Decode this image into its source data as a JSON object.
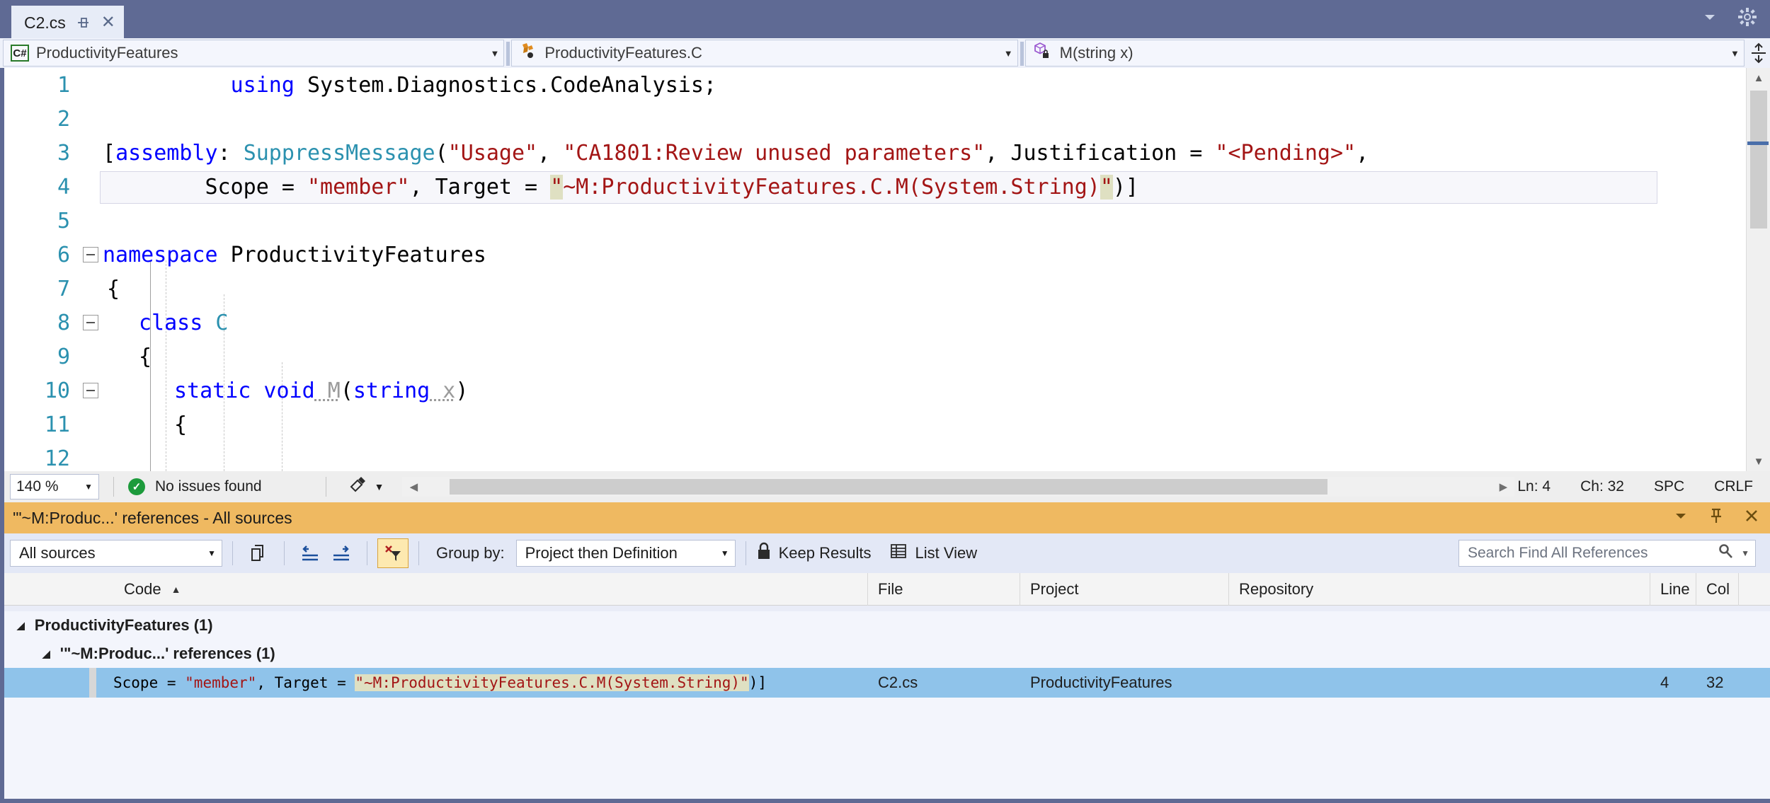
{
  "window": {
    "controls": {
      "dropdown": "chevron-down-icon",
      "settings": "gear-icon"
    }
  },
  "tab": {
    "label": "C2.cs",
    "pin_icon": "pin-icon",
    "close_icon": "close-icon"
  },
  "navbar": {
    "project_combo": {
      "icon": "csharp-file-icon",
      "value": "ProductivityFeatures",
      "arrow": "▼"
    },
    "type_combo": {
      "icon": "class-icon",
      "value": "ProductivityFeatures.C",
      "arrow": "▼"
    },
    "member_combo": {
      "icon": "method-private-icon",
      "value": "M(string x)",
      "arrow": "▼"
    },
    "split_button": "split-editor-icon"
  },
  "editor": {
    "lines": [
      {
        "num": "1",
        "fold": null
      },
      {
        "num": "2",
        "fold": null
      },
      {
        "num": "3",
        "fold": null
      },
      {
        "num": "4",
        "fold": null
      },
      {
        "num": "5",
        "fold": null
      },
      {
        "num": "6",
        "fold": "collapse"
      },
      {
        "num": "7",
        "fold": null
      },
      {
        "num": "8",
        "fold": "collapse"
      },
      {
        "num": "9",
        "fold": null
      },
      {
        "num": "10",
        "fold": "collapse"
      },
      {
        "num": "11",
        "fold": null
      },
      {
        "num": "12",
        "fold": null
      }
    ],
    "code": {
      "l1_using": "using",
      "l1_ns": " System.Diagnostics.CodeAnalysis;",
      "l3_open": "[",
      "l3_assembly": "assembly",
      "l3_colon": ": ",
      "l3_attr": "SuppressMessage",
      "l3_paren": "(",
      "l3_usage": "\"Usage\"",
      "l3_comma1": ", ",
      "l3_ca1801": "\"CA1801:Review unused parameters\"",
      "l3_comma2": ", ",
      "l3_just": "Justification = ",
      "l3_pending": "\"<Pending>\"",
      "l3_trailcomma": ",",
      "l4_scope": "        Scope = ",
      "l4_member": "\"member\"",
      "l4_comma": ", ",
      "l4_target": "Target = ",
      "l4_quote_open": "\"",
      "l4_ref": "~M:ProductivityFeatures.C.M(System.String)",
      "l4_quote_close": "\"",
      "l4_tail": ")]",
      "l6_kw": "namespace",
      "l6_name": " ProductivityFeatures",
      "l7": "{",
      "l8_kw": "class",
      "l8_name": " C",
      "l9": "{",
      "l10_static": "static",
      "l10_void": " void",
      "l10_m": " M",
      "l10_paren1": "(",
      "l10_string": "string",
      "l10_x": " x",
      "l10_paren2": ")",
      "l11": "{"
    }
  },
  "status": {
    "zoom": "140 %",
    "zoom_arrow": "▼",
    "issues_icon": "check-circle-icon",
    "issues": "No issues found",
    "brush_icon": "cleanup-brush-icon",
    "brush_arrow": "▼",
    "scroll_left": "◀",
    "scroll_right": "▶",
    "line": "Ln: 4",
    "char": "Ch: 32",
    "spaces": "SPC",
    "eol": "CRLF"
  },
  "find_all_references": {
    "title": "'\"~M:Produc...' references - All sources",
    "header_buttons": {
      "dropdown": "chevron-down-icon",
      "pin": "pin-icon",
      "close": "close-icon"
    },
    "toolbar": {
      "sources_value": "All sources",
      "sources_arrow": "▼",
      "copy_icon": "copy-icon",
      "prev_icon": "previous-location-icon",
      "next_icon": "next-location-icon",
      "clear_filter_icon": "clear-filter-icon",
      "group_by_label": "Group by:",
      "group_by_value": "Project then Definition",
      "group_by_arrow": "▼",
      "keep_results_icon": "lock-icon",
      "keep_results_label": "Keep Results",
      "list_view_icon": "grid-icon",
      "list_view_label": "List View",
      "search_placeholder": "Search Find All References",
      "search_icon": "search-icon",
      "search_arrow": "▼"
    },
    "columns": [
      {
        "key": "code",
        "label": "Code",
        "sorted": true,
        "sort_caret": "▲"
      },
      {
        "key": "file",
        "label": "File"
      },
      {
        "key": "project",
        "label": "Project"
      },
      {
        "key": "repository",
        "label": "Repository"
      },
      {
        "key": "line",
        "label": "Line"
      },
      {
        "key": "col",
        "label": "Col"
      }
    ],
    "tree": {
      "group1": {
        "caret": "◢",
        "label": "ProductivityFeatures (1)"
      },
      "group2": {
        "caret": "◢",
        "label": "'\"~M:Produc...' references (1)"
      }
    },
    "result_row": {
      "code_prefix": "Scope = ",
      "code_member": "\"member\"",
      "code_mid": ", Target = ",
      "code_ref": "\"~M:ProductivityFeatures.C.M(System.String)\"",
      "code_suffix": ")]",
      "file": "C2.cs",
      "project": "ProductivityFeatures",
      "repository": "",
      "line": "4",
      "col": "32"
    }
  },
  "colors": {
    "chrome": "#5f6a94",
    "panel_header": "#efb961",
    "selection": "#8fc3ea",
    "keyword": "#0000ff",
    "type": "#2b91af",
    "string": "#a31515",
    "reference_highlight": "#dfe0c2"
  }
}
